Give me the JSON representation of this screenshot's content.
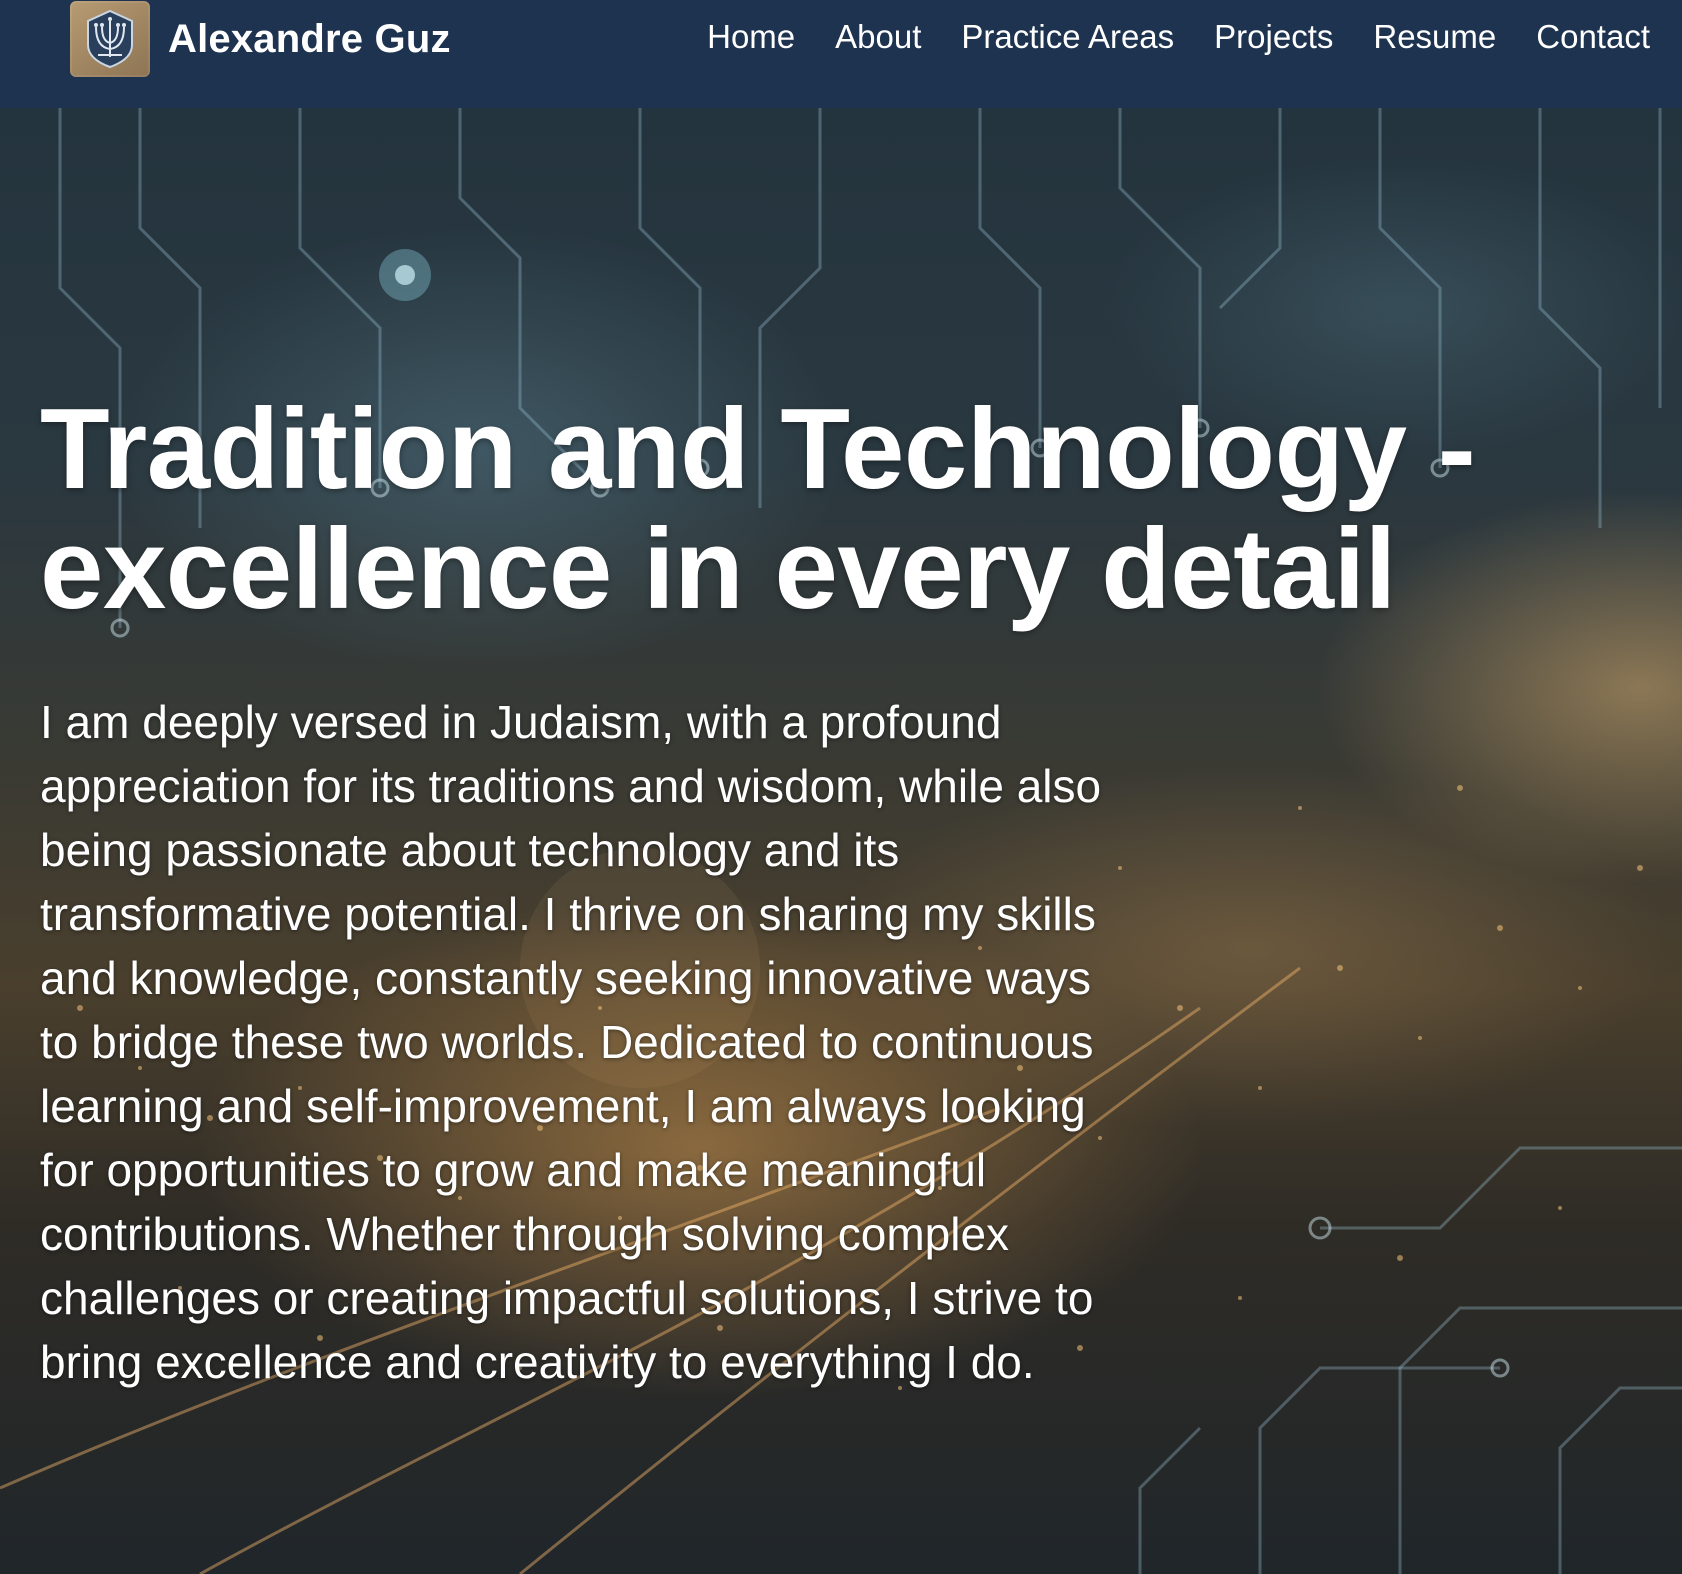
{
  "header": {
    "brand_name": "Alexandre Guz",
    "logo_icon": "circuit-menorah-logo",
    "nav": [
      {
        "label": "Home"
      },
      {
        "label": "About"
      },
      {
        "label": "Practice Areas"
      },
      {
        "label": "Projects"
      },
      {
        "label": "Resume"
      },
      {
        "label": "Contact"
      }
    ]
  },
  "hero": {
    "title": "Tradition and Technology - excellence in every detail",
    "body": "I am deeply versed in Judaism, with a profound appreciation for its traditions and wisdom, while also being passionate about technology and its transformative potential. I thrive on sharing my skills and knowledge, constantly seeking innovative ways to bridge these two worlds. Dedicated to continuous learning and self-improvement, I am always looking for opportunities to grow and make meaningful contributions. Whether through solving complex challenges or creating impactful solutions, I strive to bring excellence and creativity to everything I do."
  },
  "colors": {
    "header_bg": "#1e3350",
    "text": "#ffffff"
  }
}
